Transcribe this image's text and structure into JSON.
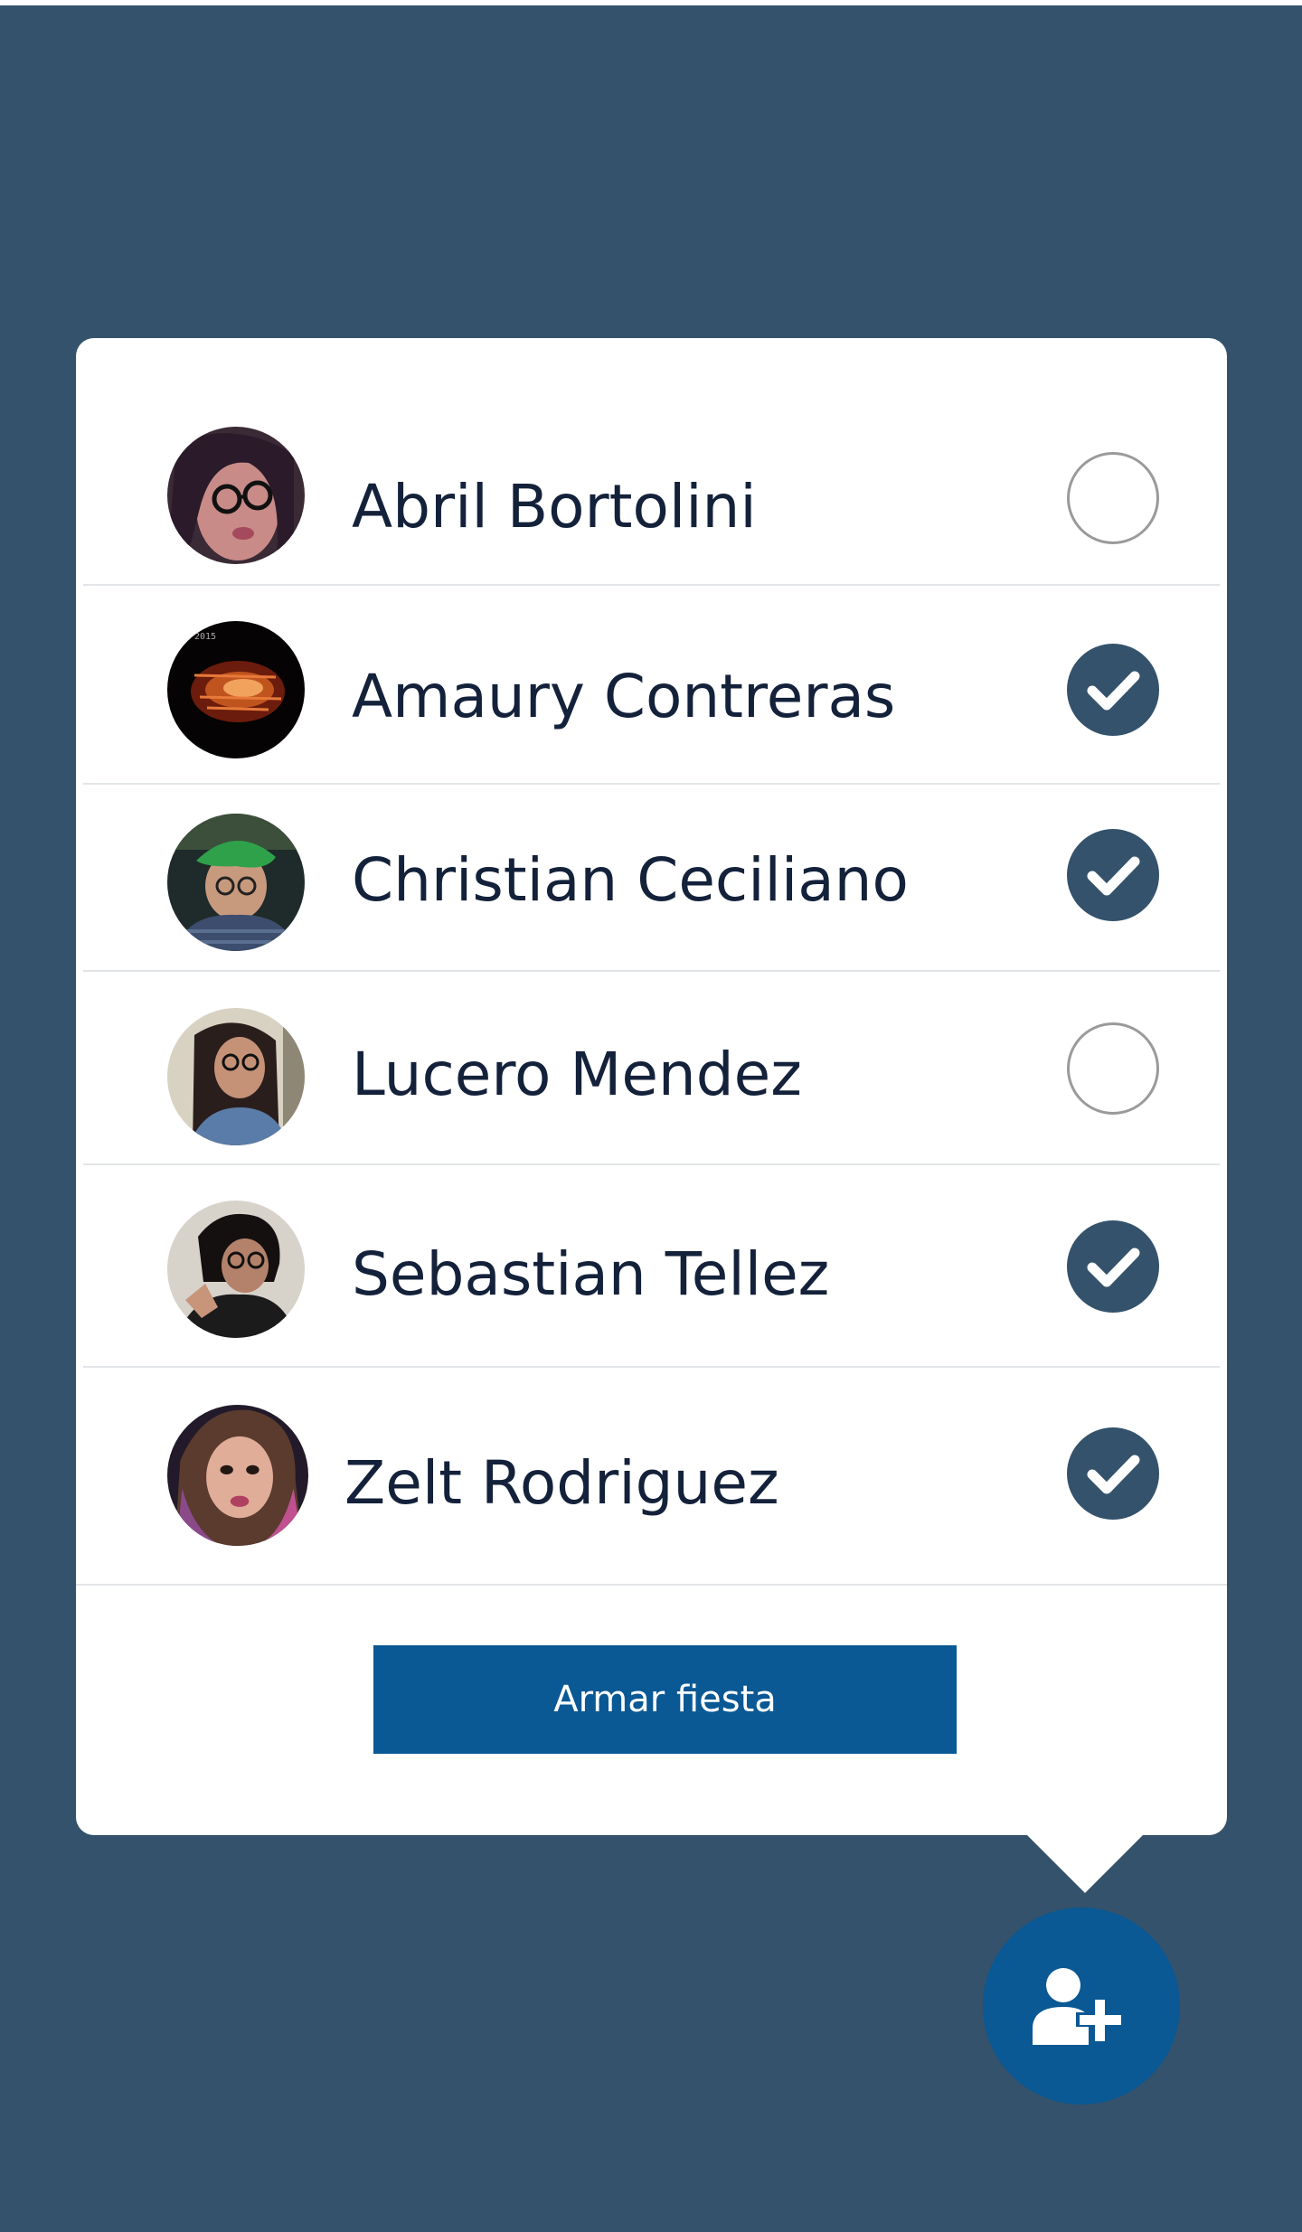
{
  "friends": [
    {
      "name": "Abril Bortolini",
      "selected": false
    },
    {
      "name": "Amaury Contreras",
      "selected": true
    },
    {
      "name": "Christian Ceciliano",
      "selected": true
    },
    {
      "name": "Lucero Mendez",
      "selected": false
    },
    {
      "name": "Sebastian Tellez",
      "selected": true
    },
    {
      "name": "Zelt Rodriguez",
      "selected": true
    }
  ],
  "actions": {
    "party_label": "Armar fiesta"
  },
  "icons": {
    "fab": "add-user-icon",
    "checked": "checkmark-icon"
  },
  "colors": {
    "background": "#34526b",
    "primary": "#0a5894",
    "check_on": "#34526b",
    "text": "#14213a"
  }
}
